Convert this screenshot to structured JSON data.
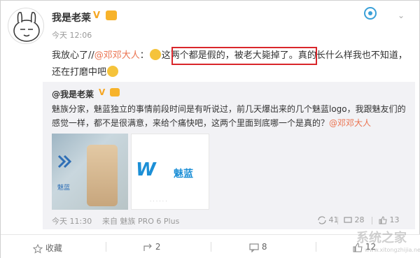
{
  "post": {
    "username": "我是老莱",
    "verified_badge": "V",
    "time": "今天 12:06",
    "text_part1": "我放心了//",
    "mention": "@邓邓大人",
    "text_part2": "：",
    "highlighted": "这两个都是假的，被老大毙掉了。",
    "text_part3": "真的长什么样我也不知道，还在打磨中吧",
    "highlight_color": "#d9262b",
    "mention_color": "#eb7350"
  },
  "quoted": {
    "username": "@我是老莱",
    "verified_badge": "V",
    "text": "魅族分家，魅蓝独立的事情前段时间是有听说过，前几天爆出来的几个魅蓝logo，我跟魅友们的感觉一样，都不是很满意，来给个痛快吧，这两个里面到底哪一个是真的？",
    "mention": "@邓邓大人",
    "image1_caption": "魅蓝",
    "image2_text": "魅蓝",
    "time": "今天 11:30",
    "source": "来自 魅族 PRO 6 Plus",
    "comments": "41",
    "reposts": "28",
    "likes": "13"
  },
  "footer": {
    "favorite_label": "收藏",
    "repost_count": "2",
    "comment_count": "8",
    "like_count": "12"
  },
  "watermark": {
    "logo": "系统之家",
    "url": "www.xitongzhijia.net"
  }
}
